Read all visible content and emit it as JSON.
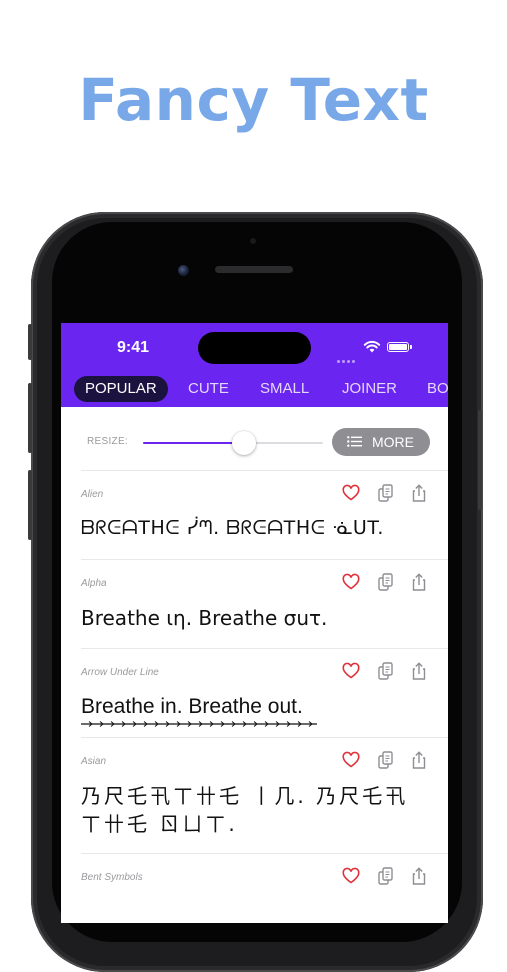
{
  "headline": "Fancy Text",
  "status": {
    "time": "9:41"
  },
  "tabs": [
    {
      "label": "POPULAR",
      "active": true
    },
    {
      "label": "CUTE"
    },
    {
      "label": "SMALL"
    },
    {
      "label": "JOINER"
    },
    {
      "label": "BO"
    }
  ],
  "resize": {
    "label": "RESIZE:",
    "slider_fraction": 0.56
  },
  "more_label": "MORE",
  "styles": [
    {
      "name": "Alien",
      "text": "ᗷᖇᕮᗩTᕼᕮ ᓰᘉ. ᗷᖇᕮᗩTᕼᕮ ᓍᑌT."
    },
    {
      "name": "Alpha",
      "text": "Breathe ιη. Breathe σuτ."
    },
    {
      "name": "Arrow Under Line",
      "text": "Breathe in. Breathe out."
    },
    {
      "name": "Asian",
      "text": "乃尺乇卂ㄒ卄乇 丨几. 乃尺乇卂ㄒ卄乇 ㄖㄩㄒ."
    },
    {
      "name": "Bent Symbols",
      "text": ""
    }
  ],
  "colors": {
    "accent": "#6b25f0",
    "headline": "#78a8e8",
    "heart": "#e0303a",
    "icon_gray": "#8e8e93"
  }
}
